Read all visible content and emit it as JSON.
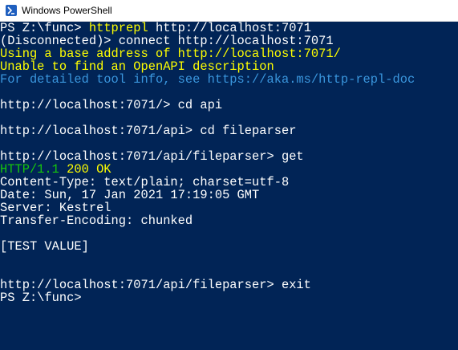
{
  "window": {
    "title": "Windows PowerShell",
    "icon": "powershell-icon"
  },
  "colors": {
    "background": "#012456",
    "text": "#ffffff",
    "prompt_command": "#ffff00",
    "info": "#3a96dd",
    "http_version": "#16c60c"
  },
  "console": {
    "line1": {
      "prefix": "PS Z:\\func> ",
      "command": "httprepl",
      "rest": " http://localhost:7071"
    },
    "line2": "(Disconnected)> connect http://localhost:7071",
    "line3": "Using a base address of http://localhost:7071/",
    "line4": "Unable to find an OpenAPI description",
    "line5": "For detailed tool info, see https://aka.ms/http-repl-doc",
    "line6": "http://localhost:7071/> cd api",
    "line7": "http://localhost:7071/api> cd fileparser",
    "line8": "http://localhost:7071/api/fileparser> get",
    "line9": {
      "http_version": "HTTP/1.1",
      "status": " 200 OK"
    },
    "line10": "Content-Type: text/plain; charset=utf-8",
    "line11": "Date: Sun, 17 Jan 2021 17:19:05 GMT",
    "line12": "Server: Kestrel",
    "line13": "Transfer-Encoding: chunked",
    "line14": "[TEST VALUE]",
    "line15": "http://localhost:7071/api/fileparser> exit",
    "line16": "PS Z:\\func>"
  }
}
